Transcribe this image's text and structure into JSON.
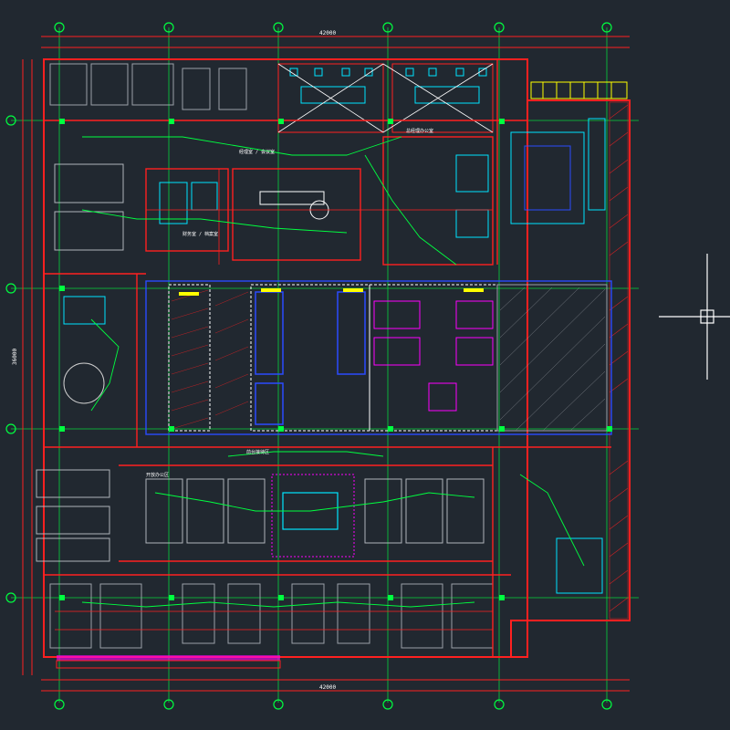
{
  "canvas": {
    "background": "#212830"
  },
  "colors": {
    "wall": "#ff2020",
    "grid": "#ff2020",
    "green": "#00ff40",
    "cyan": "#00e5ff",
    "blue": "#2a4bff",
    "magenta": "#ff00ff",
    "yellow": "#ffff00",
    "white": "#ffffff",
    "gray": "#9aa0a8"
  },
  "icons": {
    "crosshair": "crosshair-cursor-icon",
    "axis_bubble": "axis-bubble-icon"
  },
  "dimensions": {
    "top_overall": "42000",
    "bottom_overall": "42000",
    "left_overall": "36000"
  },
  "room_labels": [
    "经理室 / 会议室",
    "总经理办公室",
    "财务室 / 档案室",
    "前台接待区",
    "开放办公区"
  ]
}
